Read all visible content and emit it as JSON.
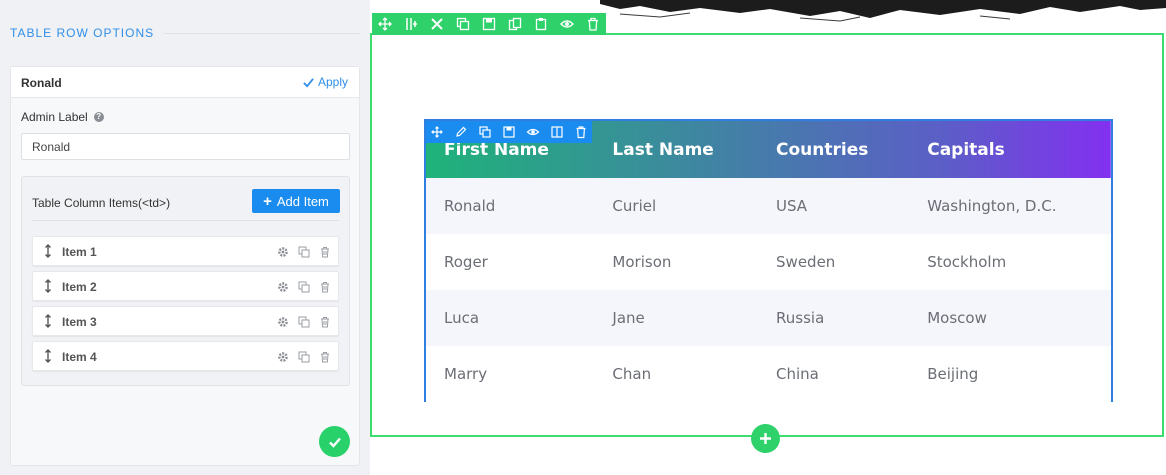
{
  "panel": {
    "title": "TABLE ROW OPTIONS",
    "row_name": "Ronald",
    "apply_label": "Apply",
    "admin_label": "Admin Label",
    "admin_value": "Ronald",
    "items_label": "Table Column Items(<td>)",
    "add_item_label": "Add Item",
    "items": [
      {
        "label": "Item 1"
      },
      {
        "label": "Item 2"
      },
      {
        "label": "Item 3"
      },
      {
        "label": "Item 4"
      }
    ]
  },
  "table": {
    "headers": [
      "First Name",
      "Last Name",
      "Countries",
      "Capitals"
    ],
    "rows": [
      [
        "Ronald",
        "Curiel",
        "USA",
        "Washington, D.C."
      ],
      [
        "Roger",
        "Morison",
        "Sweden",
        "Stockholm"
      ],
      [
        "Luca",
        "Jane",
        "Russia",
        "Moscow"
      ],
      [
        "Marry",
        "Chan",
        "China",
        "Beijing"
      ]
    ]
  },
  "colors": {
    "accent_blue": "#1a8cf0",
    "accent_green": "#2fd26a",
    "header_gradient_start": "#1fb37a",
    "header_gradient_end": "#8330f0"
  },
  "icons": {
    "section_toolbar": [
      "move-icon",
      "columns-icon",
      "tools-icon",
      "duplicate-icon",
      "save-icon",
      "copy-icon",
      "paste-icon",
      "eye-icon",
      "trash-icon"
    ],
    "table_toolbar": [
      "move-icon",
      "edit-icon",
      "duplicate-icon",
      "save-icon",
      "eye-icon",
      "columns-icon",
      "trash-icon"
    ]
  }
}
